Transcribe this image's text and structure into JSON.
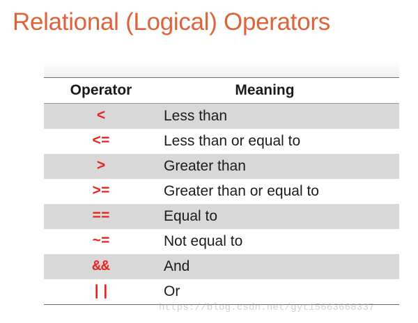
{
  "title": "Relational (Logical) Operators",
  "table": {
    "headers": {
      "operator": "Operator",
      "meaning": "Meaning"
    },
    "rows": [
      {
        "operator": "<",
        "meaning": "Less than"
      },
      {
        "operator": "<=",
        "meaning": "Less than or equal to"
      },
      {
        "operator": ">",
        "meaning": "Greater than"
      },
      {
        "operator": ">=",
        "meaning": "Greater than or equal to"
      },
      {
        "operator": "==",
        "meaning": "Equal to"
      },
      {
        "operator": "~=",
        "meaning": "Not equal to"
      },
      {
        "operator": "&&",
        "meaning": "And"
      },
      {
        "operator": "||",
        "meaning": "Or"
      }
    ]
  },
  "watermark": "https://blog.csdn.net/gyt15663668337",
  "colors": {
    "title": "#e0623a",
    "operator_symbol": "#e8231c",
    "shaded_row": "#d8d8d8"
  }
}
